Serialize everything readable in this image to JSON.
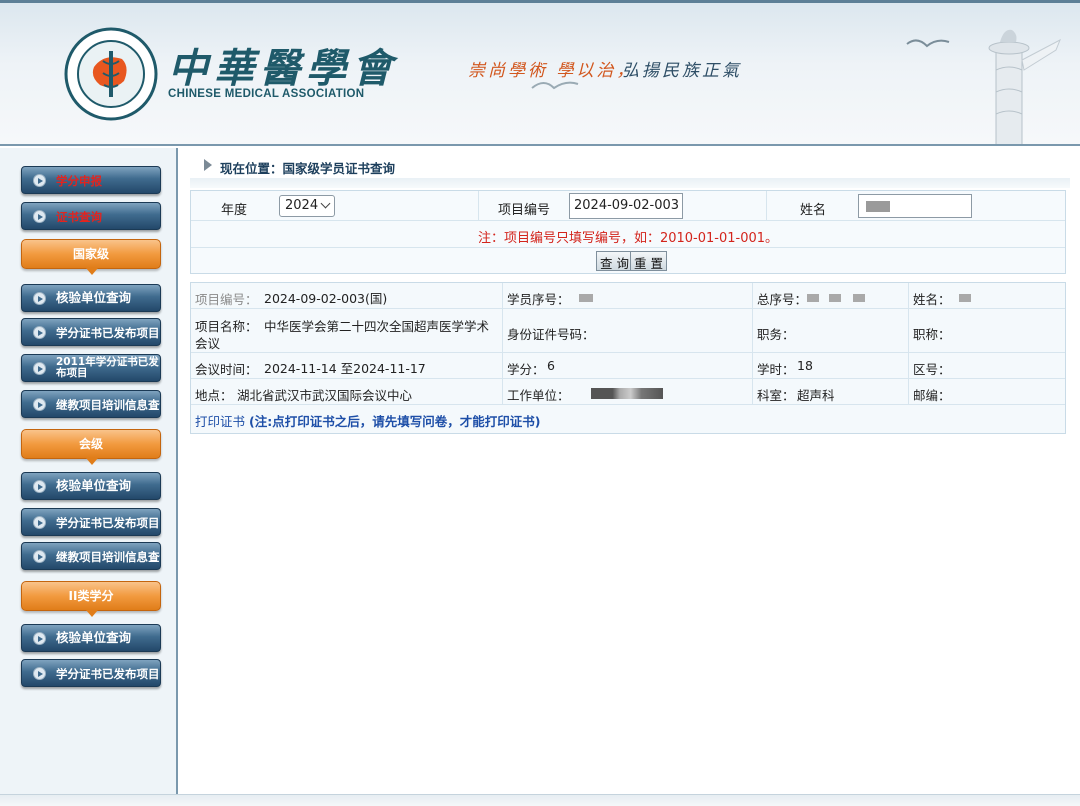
{
  "header": {
    "logo_seal_text": "中华医学会",
    "logo_seal_english": "CHINESE MEDICAL ASSOCIATION",
    "logo_chinese": "中華醫學會",
    "logo_english": "CHINESE MEDICAL ASSOCIATION",
    "slogan_1": "崇尚學術 學以治，",
    "slogan_2": "弘揚民族正氣"
  },
  "sidebar": {
    "top_buttons": [
      {
        "label": "学分申报"
      },
      {
        "label": "证书查询"
      }
    ],
    "sections": [
      {
        "heading": "国家级",
        "items": [
          {
            "label": "核验单位查询"
          },
          {
            "label": "学分证书已发布项目"
          },
          {
            "label": "2011年学分证书已发布项目"
          },
          {
            "label": "继教项目培训信息查询"
          }
        ]
      },
      {
        "heading": "会级",
        "items": [
          {
            "label": "核验单位查询"
          },
          {
            "label": "学分证书已发布项目"
          },
          {
            "label": "继教项目培训信息查询"
          }
        ]
      },
      {
        "heading": "II类学分",
        "items": [
          {
            "label": "核验单位查询"
          },
          {
            "label": "学分证书已发布项目"
          }
        ]
      }
    ]
  },
  "breadcrumb": {
    "text": "现在位置：国家级学员证书查询"
  },
  "search": {
    "year_label": "年度",
    "year_value": "2024",
    "code_label": "项目编号",
    "code_value": "2024-09-02-003",
    "name_label": "姓名",
    "note": "注：项目编号只填写编号，如：2010-01-01-001。",
    "query_button": "查 询",
    "reset_button": "重 置"
  },
  "result": {
    "project_code_label": "项目编号：",
    "project_code_value": "2024-09-02-003(国)",
    "student_no_label": "学员序号：",
    "total_no_label": "总序号：",
    "name_label": "姓名：",
    "project_name_label": "项目名称：",
    "project_name_value_1": "中华医学会第二十四次全国超声医学学术",
    "project_name_value_2": "会议",
    "id_label": "身份证件号码：",
    "duty_label": "职务：",
    "title_label": "职称：",
    "meeting_time_label": "会议时间：",
    "meeting_time_value": "2024-11-14 至2024-11-17",
    "credit_label": "学分：",
    "credit_value": "6",
    "hours_label": "学时：",
    "hours_value": "18",
    "area_label": "区号：",
    "location_label": "地点：",
    "location_value": "湖北省武汉市武汉国际会议中心",
    "work_unit_label": "工作单位：",
    "department_label": "科室：",
    "department_value": "超声科",
    "postcode_label": "邮编：",
    "print_link": "打印证书",
    "print_note": "(注:点打印证书之后，请先填写问卷，才能打印证书)"
  }
}
